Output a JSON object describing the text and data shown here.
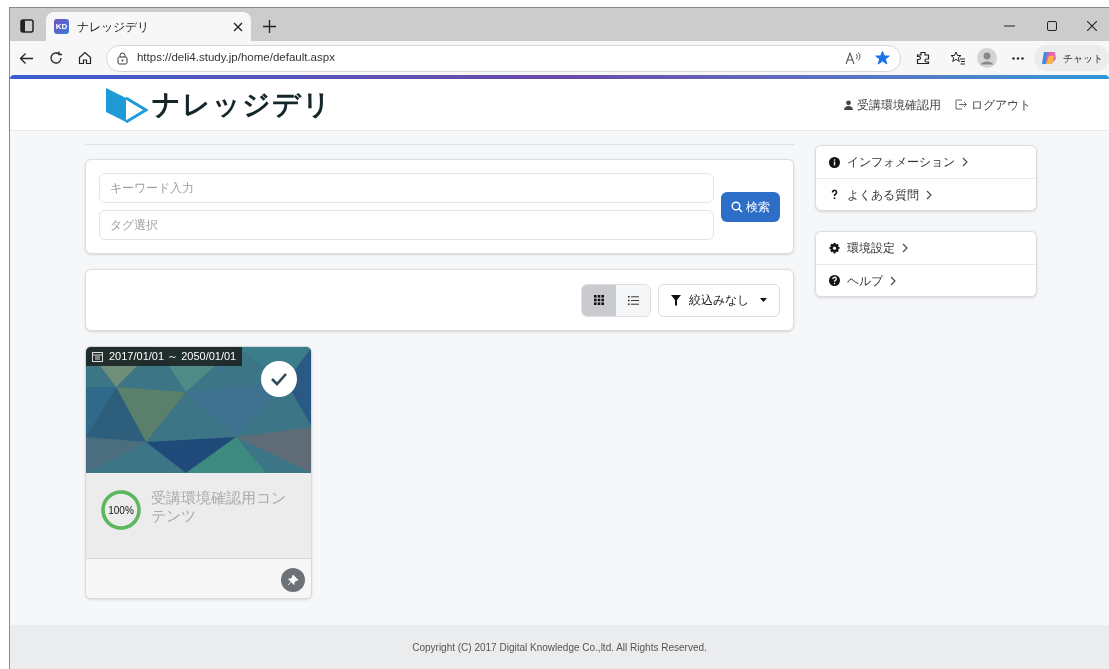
{
  "browser": {
    "tab": {
      "favicon": "KD",
      "title": "ナレッジデリ"
    },
    "url": "https://deli4.study.jp/home/default.aspx",
    "favorite": true,
    "chat_label": "チャット"
  },
  "header": {
    "logo": "ナレッジデリ",
    "user": "受講環境確認用",
    "logout": "ログアウト"
  },
  "search": {
    "keyword_placeholder": "キーワード入力",
    "tag_placeholder": "タグ選択",
    "button": "検索"
  },
  "view_toggle": [
    {
      "kind": "grid",
      "selected": true
    },
    {
      "kind": "list",
      "selected": false
    }
  ],
  "filter": {
    "label": "絞込みなし"
  },
  "courses": [
    {
      "period": "2017/01/01 ～ 2050/01/01",
      "completed": true,
      "progress": "100%",
      "level": 1,
      "title": "受講環境確認用コンテンツ"
    }
  ],
  "side_menus": [
    [
      {
        "kind": "info",
        "label": "インフォメーション"
      },
      {
        "kind": "question",
        "label": "よくある質問"
      }
    ],
    [
      {
        "kind": "gear",
        "label": "環境設定"
      },
      {
        "kind": "help",
        "label": "ヘルプ"
      }
    ]
  ],
  "footer": "Copyright (C) 2017 Digital Knowledge Co.,ltd. All Rights Reserved."
}
